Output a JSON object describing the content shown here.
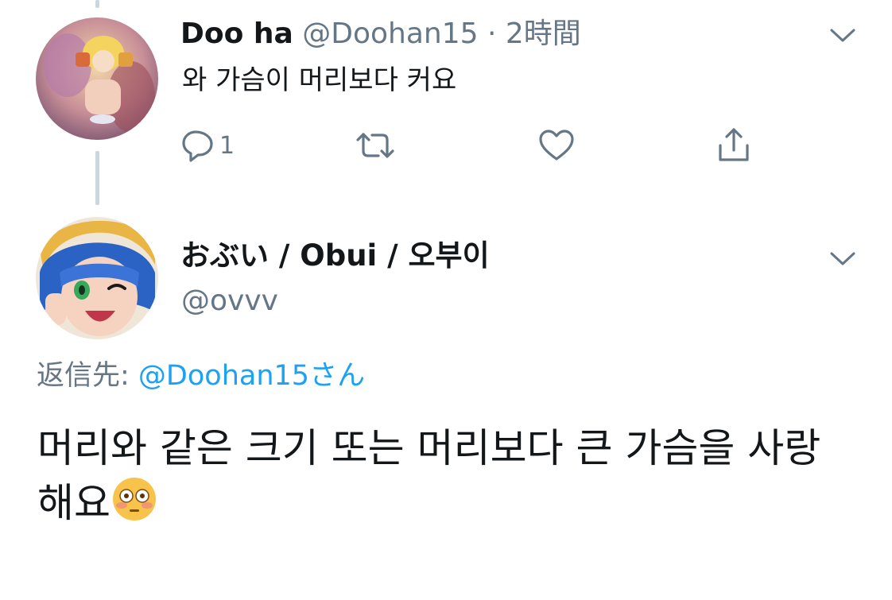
{
  "tweet1": {
    "display_name": "Doo ha",
    "handle": "@Doohan15",
    "separator": "·",
    "time": "2時間",
    "text": "와 가슴이 머리보다 커요",
    "reply_count": "1",
    "avatar_icon": "anime-avatar-icon"
  },
  "tweet2": {
    "display_name": "おぶい / Obui / 오부이",
    "handle": "@ovvv",
    "reply_prefix": "返信先: ",
    "reply_mention": "@Doohan15",
    "reply_suffix": "さん",
    "text": "머리와 같은 크기 또는 머리보다 큰 가슴을 사랑 해요",
    "emoji_name": "flushed-face-emoji",
    "avatar_icon": "anime-avatar-icon"
  },
  "colors": {
    "text": "#14171a",
    "secondary": "#657786",
    "link": "#1da1f2",
    "thread_line": "#ccd6dd"
  }
}
